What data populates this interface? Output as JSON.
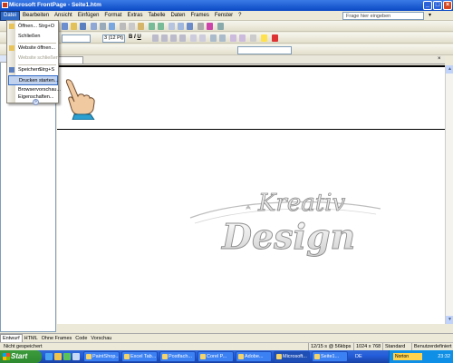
{
  "window": {
    "title": "Microsoft FrontPage - Seite1.htm"
  },
  "menubar": {
    "items": [
      "Datei",
      "Bearbeiten",
      "Ansicht",
      "Einfügen",
      "Format",
      "Extras",
      "Tabelle",
      "Daten",
      "Frames",
      "Fenster",
      "?"
    ],
    "help_placeholder": "Frage hier eingeben"
  },
  "toolbar2": {
    "font_size": "3 (12 Pt)"
  },
  "file_menu": {
    "items": [
      {
        "label": "Öffnen...",
        "shortcut": "Strg+O",
        "disabled": false
      },
      {
        "label": "Schließen",
        "shortcut": "",
        "disabled": false
      },
      {
        "label": "Website öffnen...",
        "shortcut": "",
        "disabled": false
      },
      {
        "label": "Website schließen",
        "shortcut": "",
        "disabled": true
      },
      {
        "label": "Speichern",
        "shortcut": "Strg+S",
        "disabled": false
      },
      {
        "label": "Drucken starten...",
        "shortcut": "",
        "disabled": false
      },
      {
        "label": "Browservorschau...",
        "shortcut": "",
        "disabled": false
      },
      {
        "label": "Eigenschaften...",
        "shortcut": "",
        "disabled": false
      }
    ]
  },
  "view_tabs": [
    "Entwurf",
    "HTML",
    "Ohne Frames",
    "Code",
    "Vorschau"
  ],
  "status": {
    "left": "Nicht gespeichert",
    "middle": "12/15 s @ 56kbps",
    "size": "1024 x 768",
    "mode": "Standard",
    "tag": "Benutzerdefiniert"
  },
  "watermark": {
    "line1": "Kreativ",
    "line2": "Design"
  },
  "taskbar": {
    "start_label": "Start",
    "tasks": [
      "PaintShop...",
      "Excel Tab...",
      "Postfach...",
      "Corel P...",
      "Adobe...",
      "Microsoft...",
      "Seite1..."
    ],
    "tray_label": "Norton",
    "clock": "23:32",
    "lang": "DE"
  },
  "colors": {
    "titlebar": "#0a49c4",
    "menu_highlight": "#c1d2ee",
    "taskbar": "#245edb",
    "start": "#3c9a3c"
  }
}
